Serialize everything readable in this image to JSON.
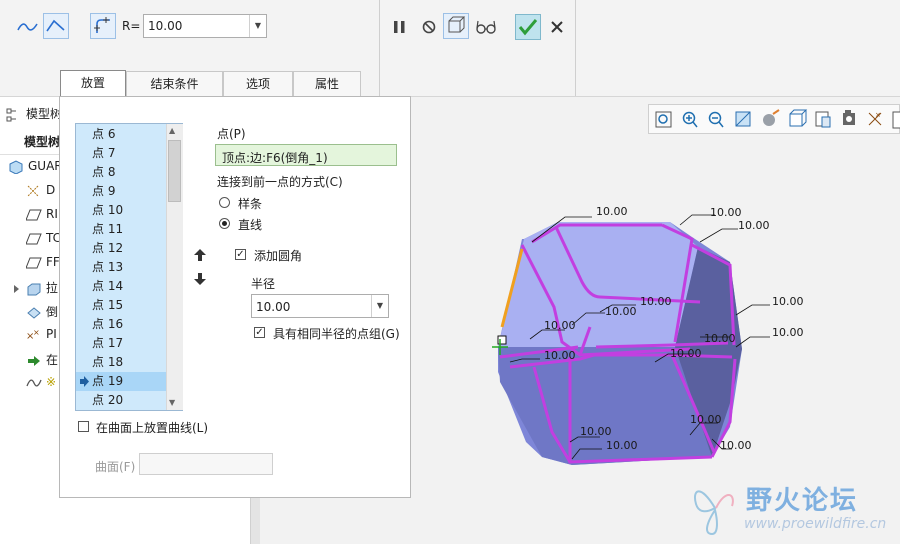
{
  "dashboard": {
    "r_label": "R=",
    "r_value": "10.00",
    "tabs": [
      "放置",
      "结束条件",
      "选项",
      "属性"
    ]
  },
  "model_tree": {
    "header": "模型树",
    "subheader": "模型树",
    "rows": [
      {
        "label": "GUAR",
        "icon": "part-icon"
      },
      {
        "label": "D",
        "icon": "datum-axis-icon"
      },
      {
        "label": "RI",
        "icon": "datum-plane-icon"
      },
      {
        "label": "TC",
        "icon": "datum-plane-icon"
      },
      {
        "label": "FF",
        "icon": "datum-plane-icon"
      },
      {
        "label": "拉",
        "icon": "extrude-icon"
      },
      {
        "label": "倒",
        "icon": "round-icon"
      },
      {
        "label": "PI",
        "icon": "datum-point-icon"
      },
      {
        "label": "在",
        "icon": "insert-here-icon"
      },
      {
        "label": "※",
        "icon": "curve-icon"
      }
    ]
  },
  "panel": {
    "points": [
      "点 6",
      "点 7",
      "点 8",
      "点 9",
      "点 10",
      "点 11",
      "点 12",
      "点 13",
      "点 14",
      "点 15",
      "点 16",
      "点 17",
      "点 18",
      "点 19",
      "点 20"
    ],
    "selected_point": "点 19",
    "point_label": "点(P)",
    "point_value": "顶点:边:F6(倒角_1)",
    "connect_label": "连接到前一点的方式(C)",
    "option_spline": "样条",
    "option_line": "直线",
    "add_round_label": "添加圆角",
    "radius_label": "半径",
    "radius_value": "10.00",
    "same_radius_label": "具有相同半径的点组(G)",
    "place_on_surface_label": "在曲面上放置曲线(L)",
    "surface_label": "曲面(F)"
  },
  "graphics": {
    "dimension_value": "10.00",
    "watermark_title": "野火论坛",
    "watermark_url": "www.proewildfire.cn",
    "colors": {
      "part_face": "#8b93e0",
      "round_curve": "#c040e0",
      "highlight_edge": "#f0a020"
    }
  },
  "colors": {
    "list_bg": "#cfe9fb",
    "list_selected": "#a9d6f7",
    "accept_green": "#2e9e3a"
  }
}
